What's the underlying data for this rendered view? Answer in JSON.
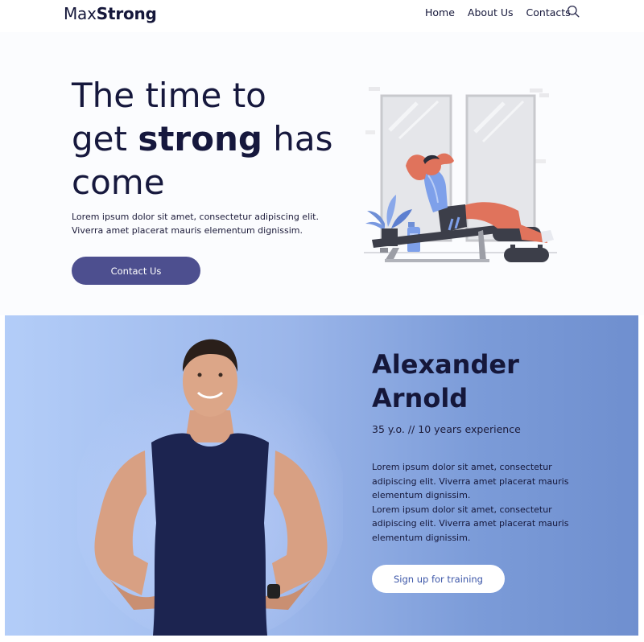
{
  "brand": {
    "name_light": "Max",
    "name_bold": "Strong"
  },
  "nav": {
    "home": "Home",
    "about": "About Us",
    "contacts": "Contacts",
    "search_icon": "search-icon"
  },
  "hero": {
    "title_line1": "The time to",
    "title_get": "get ",
    "title_strong": "strong",
    "title_has": " has",
    "title_line3": "come",
    "text": "Lorem ipsum dolor sit amet, consectetur adipiscing elit. Viverra amet placerat mauris elementum dignissim.",
    "cta": "Contact Us"
  },
  "trainer": {
    "name_first": "Alexander",
    "name_last": "Arnold",
    "meta": "35 y.o. // 10 years experience",
    "bio_1": "Lorem ipsum dolor sit amet, consectetur adipiscing elit. Viverra amet placerat mauris elementum dignissim.",
    "bio_2": "Lorem ipsum dolor sit amet, consectetur adipiscing elit. Viverra amet placerat mauris elementum dignissim.",
    "cta": "Sign up for training"
  },
  "colors": {
    "primary": "#4d4f8f",
    "text_dark": "#15173a",
    "band_start": "#b3cdf8",
    "band_end": "#6f8fcf",
    "illustration_accent": "#e0735c"
  }
}
